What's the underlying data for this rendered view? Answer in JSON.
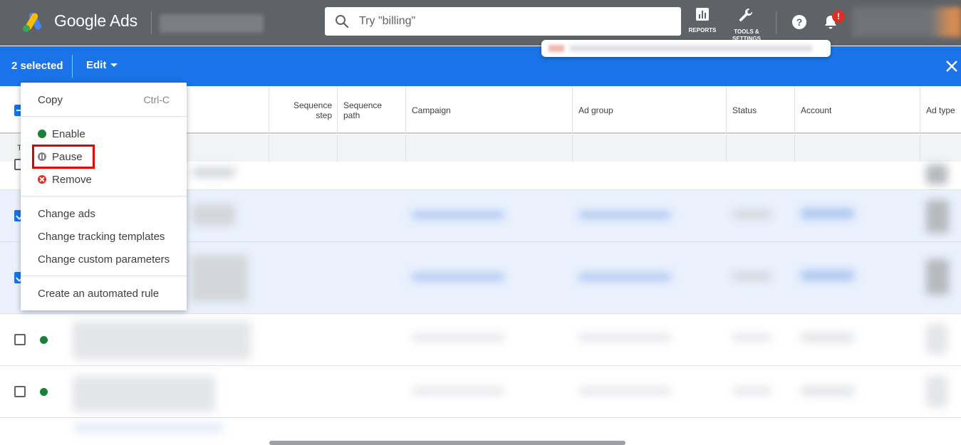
{
  "header": {
    "brand_name": "Google Ads",
    "search_placeholder": "Try \"billing\"",
    "reports_label": "REPORTS",
    "tools_label_line1": "TOOLS &",
    "tools_label_line2": "SETTINGS",
    "notification_badge": "!"
  },
  "action_bar": {
    "selected_count": "2 selected",
    "edit_label": "Edit"
  },
  "table": {
    "columns": [
      "Sequence step",
      "Sequence path",
      "Campaign",
      "Ad group",
      "Status",
      "Account",
      "Ad type"
    ],
    "total_label": "T"
  },
  "menu": {
    "copy": "Copy",
    "copy_shortcut": "Ctrl-C",
    "enable": "Enable",
    "pause": "Pause",
    "remove": "Remove",
    "change_ads": "Change ads",
    "change_tracking": "Change tracking templates",
    "change_custom": "Change custom parameters",
    "automated_rule": "Create an automated rule"
  },
  "colors": {
    "topbar": "#5f6368",
    "action_bar": "#1a73e8",
    "enable": "#188038",
    "remove": "#d93025",
    "highlight": "#e00000"
  }
}
